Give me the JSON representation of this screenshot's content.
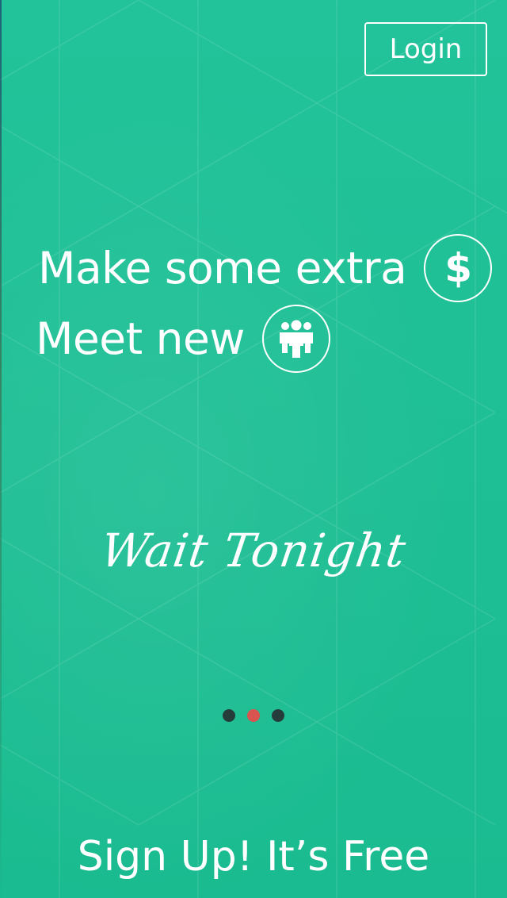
{
  "header": {
    "login_label": "Login"
  },
  "hero": {
    "line1": "Make some extra",
    "line1_icon": "dollar-icon",
    "line1_icon_glyph": "$",
    "line2": "Meet new",
    "line2_icon": "people-icon"
  },
  "brand": {
    "name": "Wait Tonight"
  },
  "pager": {
    "total": 3,
    "active_index": 1
  },
  "footer": {
    "signup_label": "Sign Up! It’s Free"
  },
  "colors": {
    "background": "#1ebd93",
    "text": "#ffffff",
    "dot_inactive": "#253c3a",
    "dot_active": "#d9534f"
  }
}
